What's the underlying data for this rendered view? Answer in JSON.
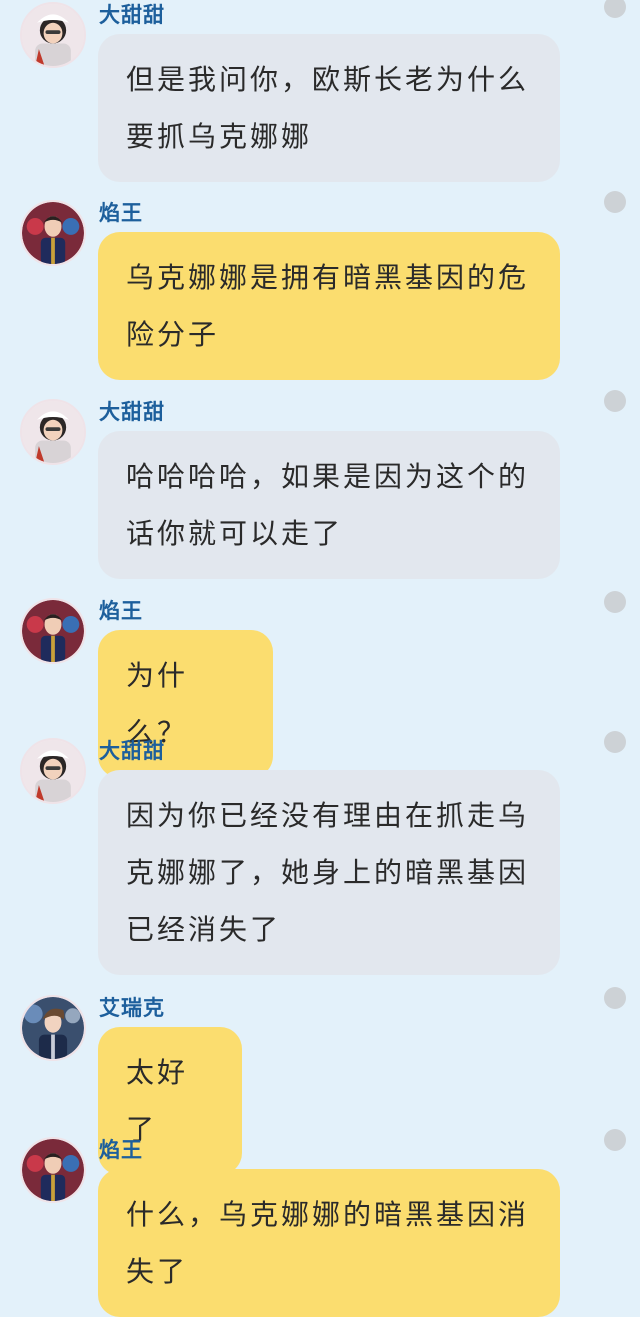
{
  "conversation": {
    "messages": [
      {
        "sender": "大甜甜",
        "text": "但是我问你，欧斯长老为什么\n要抓乌克娜娜",
        "style": "gray",
        "avatar_icon": "girl-avatar-icon"
      },
      {
        "sender": "焰王",
        "text": "乌克娜娜是拥有暗黑基因的危\n险分子",
        "style": "yellow",
        "avatar_icon": "king-avatar-icon"
      },
      {
        "sender": "大甜甜",
        "text": "哈哈哈哈，如果是因为这个的\n话你就可以走了",
        "style": "gray",
        "avatar_icon": "girl-avatar-icon"
      },
      {
        "sender": "焰王",
        "text": "为什么？",
        "style": "yellow",
        "avatar_icon": "king-avatar-icon"
      },
      {
        "sender": "大甜甜",
        "text": "因为你已经没有理由在抓走乌\n克娜娜了，她身上的暗黑基因\n已经消失了",
        "style": "gray",
        "avatar_icon": "girl-avatar-icon"
      },
      {
        "sender": "艾瑞克",
        "text": "太好了",
        "style": "yellow",
        "avatar_icon": "boy-avatar-icon"
      },
      {
        "sender": "焰王",
        "text": "什么，乌克娜娜的暗黑基因消\n失了",
        "style": "yellow",
        "avatar_icon": "king-avatar-icon"
      }
    ]
  },
  "colors": {
    "background": "#e3f1fa",
    "gray_bubble": "#e2e7ee",
    "yellow_bubble": "#fbdd6f",
    "name_text": "#1d5f9c",
    "dot": "#cdd2d6"
  }
}
